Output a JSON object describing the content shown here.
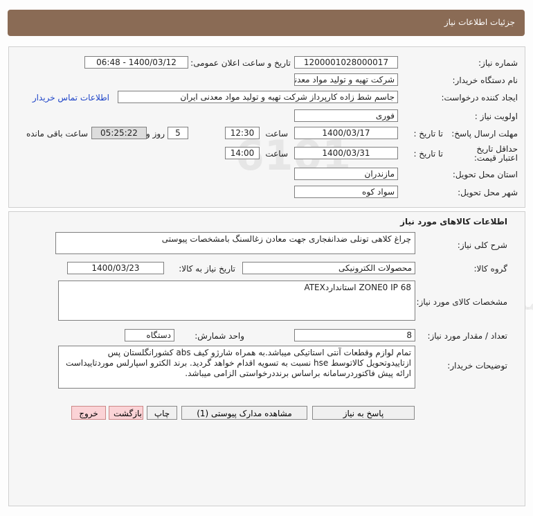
{
  "header": {
    "title": "جزئیات اطلاعات نیاز"
  },
  "info": {
    "need_number_label": "شماره نیاز:",
    "need_number": "1200001028000017",
    "announce_label": "تاریخ و ساعت اعلان عمومی:",
    "announce_value": "1400/03/12 - 06:48",
    "buyer_org_label": "نام دستگاه خریدار:",
    "buyer_org": "شرکت تهیه و تولید مواد معدنی ایران",
    "creator_label": "ایجاد کننده درخواست:",
    "creator": "جاسم شط زاده کارپرداز شرکت تهیه و تولید مواد معدنی ایران",
    "contact_link": "اطلاعات تماس خریدار",
    "priority_label": "اولویت نیاز :",
    "priority": "فوری",
    "reply_deadline_label": "مهلت ارسال پاسخ:",
    "until_date_label": "تا تاریخ :",
    "reply_date": "1400/03/17",
    "time_label": "ساعت",
    "reply_time": "12:30",
    "days": "5",
    "days_label": "روز و",
    "remaining_time": "05:25:22",
    "remaining_label": "ساعت باقی مانده",
    "validity_label": "حداقل تاریخ اعتبار قیمت:",
    "validity_until_label": "تا تاریخ :",
    "validity_date": "1400/03/31",
    "validity_time_label": "ساعت",
    "validity_time": "14:00",
    "province_label": "استان محل تحویل:",
    "province": "مازندران",
    "city_label": "شهر محل تحویل:",
    "city": "سواد کوه"
  },
  "goods": {
    "section_title": "اطلاعات کالاهای مورد نیاز",
    "desc_label": "شرح کلی نیاز:",
    "desc": "چراغ کلاهی تونلی ضدانفجاری جهت معادن زغالسنگ بامشخصات پیوستی",
    "group_label": "گروه کالا:",
    "group": "محصولات الکترونیکی",
    "need_date_label": "تاریخ نیاز به کالا:",
    "need_date": "1400/03/23",
    "spec_label": "مشخصات کالای مورد نیاز:",
    "spec": "ZONE0 IP 68 استانداردATEX",
    "qty_label": "تعداد / مقدار مورد نیاز:",
    "qty": "8",
    "unit_label": "واحد شمارش:",
    "unit": "دستگاه",
    "buyer_notes_label": "توضیحات خریدار:",
    "buyer_notes": "تمام لوازم وقطعات آنتی استاتیکی میباشد.به همراه شارژو کیف abs کشورانگلستان پس ازتاییدوتحویل کالاتوسط hse نسبت به تسویه اقدام خواهد گردید. برند الکترو اسپارلس موردتاییداست ارائه پیش فاکتوردرسامانه براساس برنددرخواستی الزامی میباشد."
  },
  "buttons": {
    "reply": "پاسخ به نیاز",
    "attachments": "مشاهده مدارک پیوستی (1)",
    "print": "چاپ",
    "back": "بازگشت",
    "exit": "خروج"
  }
}
